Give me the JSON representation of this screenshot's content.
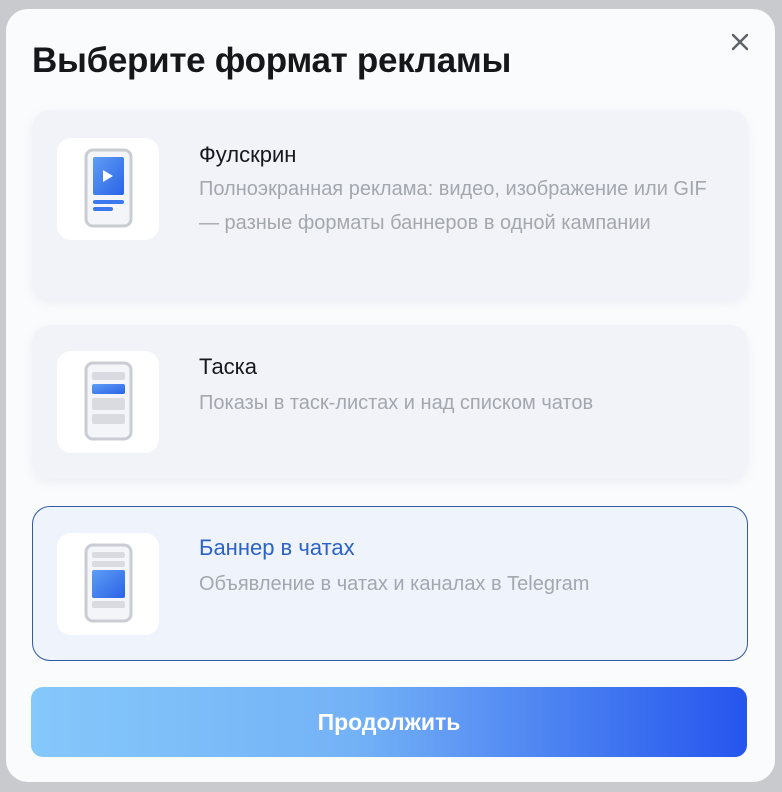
{
  "dialog": {
    "title": "Выберите формат рекламы",
    "close_icon": "close-icon"
  },
  "formats": [
    {
      "title": "Фулскрин",
      "description": "Полноэкранная реклама: видео, изображение или GIF — разные форматы баннеров в одной кампании",
      "icon": "phone-fullscreen-video-icon",
      "selected": false
    },
    {
      "title": "Таска",
      "description": "Показы в таск-листах и над списком чатов",
      "icon": "phone-task-list-icon",
      "selected": false
    },
    {
      "title": "Баннер в чатах",
      "description": "Объявление в чатах и каналах в Telegram",
      "icon": "phone-chat-banner-icon",
      "selected": true
    }
  ],
  "actions": {
    "continue_label": "Продолжить"
  },
  "colors": {
    "accent": "#2c62c5",
    "selected_border": "#2f5aa6",
    "button_gradient_start": "#85c8fb",
    "button_gradient_end": "#2555ee"
  }
}
